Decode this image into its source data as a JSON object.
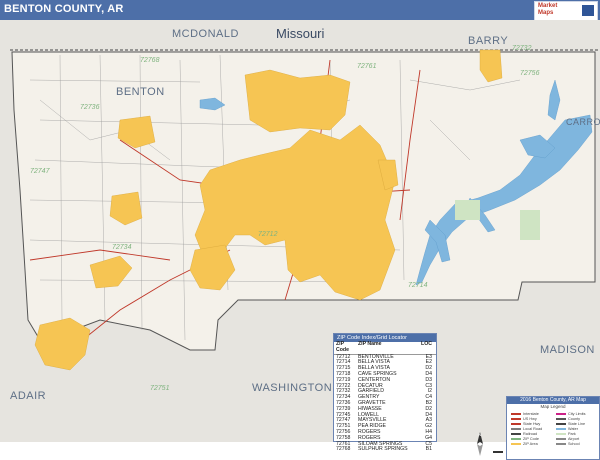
{
  "header": {
    "title": "BENTON COUNTY, AR",
    "logo_text_1": "Market",
    "logo_text_2": "Maps"
  },
  "colors": {
    "header_bar": "#4d6fa8",
    "zip_area": "#f6c553",
    "county_fill": "#f4f1ea",
    "outside_fill": "#e6e4df",
    "water": "#7fb6de",
    "major_road": "#c0392b",
    "minor_road": "#7d7d7d",
    "place_label": "#5e6f86",
    "zip_label": "#7fb37f"
  },
  "map": {
    "region_labels": [
      "MCDONALD",
      "Missouri",
      "BARRY",
      "BENTON",
      "CARROLL",
      "MADISON",
      "WASHINGTON",
      "ADAIR"
    ],
    "zip_labels": [
      "72768",
      "72756",
      "72761",
      "72732",
      "72736",
      "72747",
      "72712",
      "72734",
      "72714",
      "72751"
    ]
  },
  "index": {
    "title": "ZIP Code Index/Grid Locator",
    "headers": [
      "ZIP Code",
      "ZIP Name",
      "LOC"
    ],
    "rows": [
      [
        "72712",
        "BENTONVILLE",
        "E3"
      ],
      [
        "72714",
        "BELLA VISTA",
        "E2"
      ],
      [
        "72715",
        "BELLA VISTA",
        "D2"
      ],
      [
        "72718",
        "CAVE SPRINGS",
        "D4"
      ],
      [
        "72719",
        "CENTERTON",
        "D3"
      ],
      [
        "72722",
        "DECATUR",
        "C3"
      ],
      [
        "72732",
        "GARFIELD",
        "I2"
      ],
      [
        "72734",
        "GENTRY",
        "C4"
      ],
      [
        "72736",
        "GRAVETTE",
        "B2"
      ],
      [
        "72739",
        "HIWASSE",
        "D2"
      ],
      [
        "72745",
        "LOWELL",
        "D4"
      ],
      [
        "72747",
        "MAYSVILLE",
        "A3"
      ],
      [
        "72751",
        "PEA RIDGE",
        "G2"
      ],
      [
        "72756",
        "ROGERS",
        "H4"
      ],
      [
        "72758",
        "ROGERS",
        "G4"
      ],
      [
        "72761",
        "SILOAM SPRINGS",
        "C5"
      ],
      [
        "72768",
        "SULPHUR SPRINGS",
        "B1"
      ]
    ]
  },
  "legend": {
    "title": "2016 Benton County, AR Map",
    "subtitle": "Map Legend",
    "left_items": [
      "Interstate",
      "US Hwy",
      "State Hwy",
      "Local Road",
      "Railroad",
      "ZIP Code",
      "ZIP Area"
    ],
    "right_items": [
      "City Limits",
      "County",
      "State Line",
      "Water",
      "Park",
      "Airport",
      "School"
    ]
  },
  "scale": {
    "north_label": "N"
  }
}
